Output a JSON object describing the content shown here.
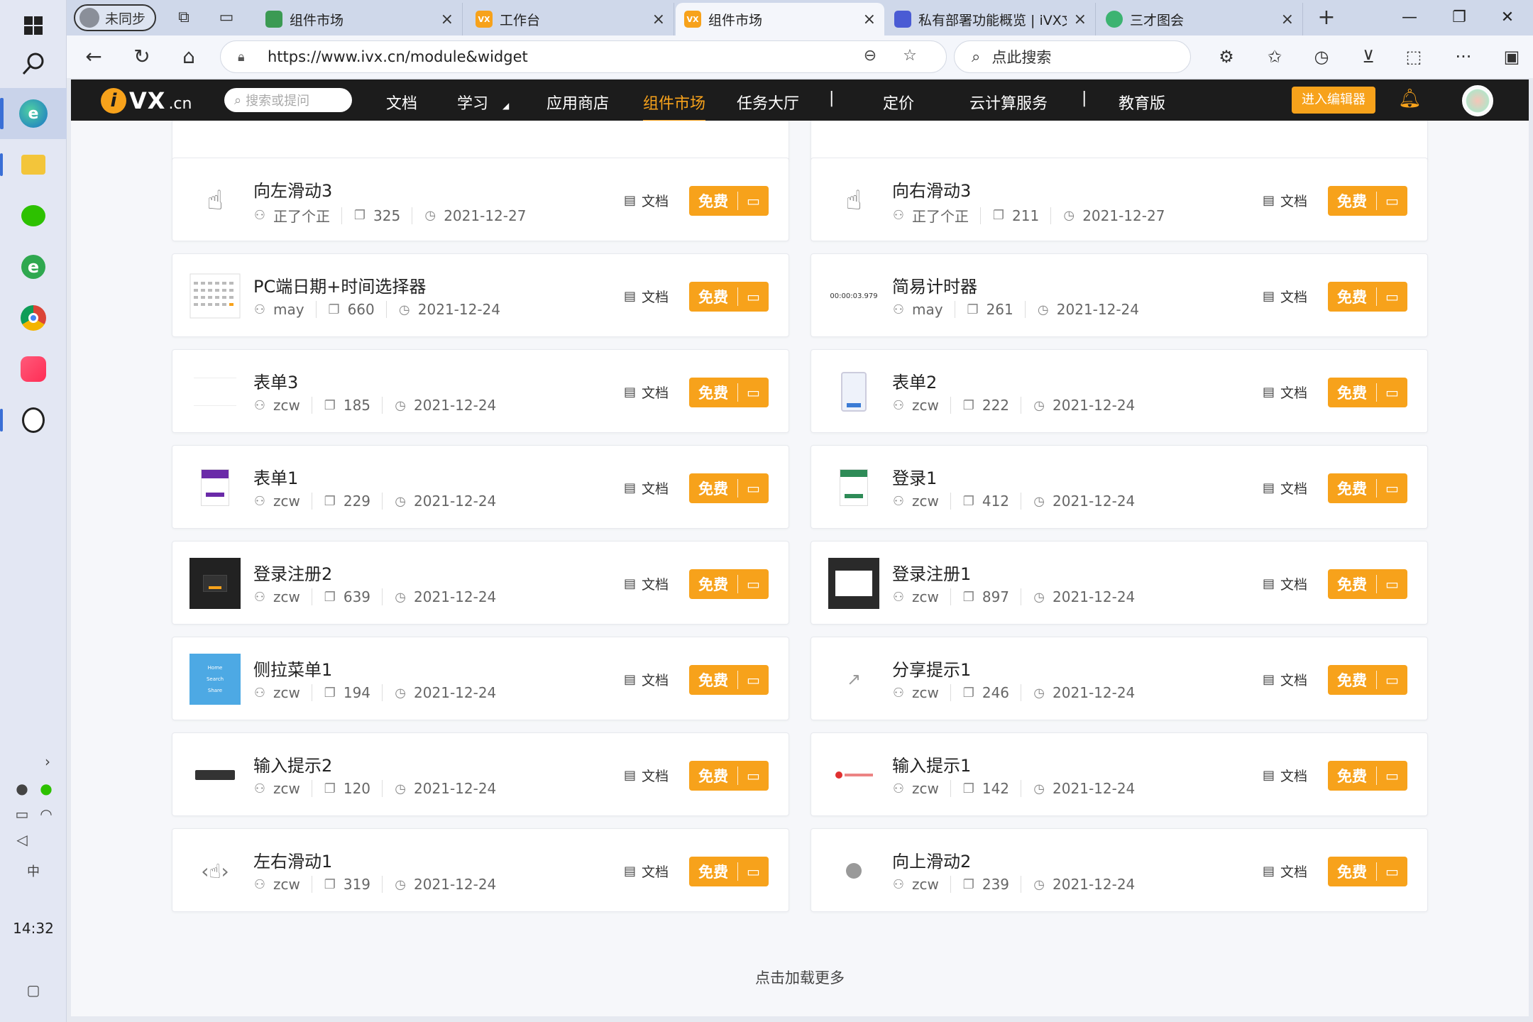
{
  "taskbar": {
    "clock": "14:32"
  },
  "browser": {
    "profile_label": "未同步",
    "tabs": [
      {
        "title": "组件市场",
        "favicon_color": "#3b9a53"
      },
      {
        "title": "工作台",
        "favicon_color": "#f7a21b",
        "favicon_text": "VX"
      },
      {
        "title": "组件市场",
        "favicon_color": "#f7a21b",
        "favicon_text": "VX"
      },
      {
        "title": "私有部署功能概览 | iVX文",
        "favicon_color": "#4a5bd4"
      },
      {
        "title": "三才图会",
        "favicon_color": "#3cb371"
      }
    ],
    "url": "https://www.ivx.cn/module&widget",
    "search_placeholder": "点此搜索"
  },
  "site": {
    "logo_text": "VX",
    "logo_domain": ".cn",
    "search_placeholder": "搜索或提问",
    "nav": [
      {
        "label": "文档"
      },
      {
        "label": "学习"
      },
      {
        "label": "应用商店"
      },
      {
        "label": "组件市场"
      },
      {
        "label": "任务大厅"
      },
      {
        "label": "定价"
      },
      {
        "label": "云计算服务"
      },
      {
        "label": "教育版"
      }
    ],
    "editor_button": "进入编辑器"
  },
  "card_labels": {
    "doc": "文档",
    "free": "免费"
  },
  "cards": [
    {
      "name": "向左滑动3",
      "author": "正了个正",
      "count": "325",
      "date": "2021-12-27"
    },
    {
      "name": "向右滑动3",
      "author": "正了个正",
      "count": "211",
      "date": "2021-12-27"
    },
    {
      "name": "PC端日期+时间选择器",
      "author": "may",
      "count": "660",
      "date": "2021-12-24"
    },
    {
      "name": "简易计时器",
      "author": "may",
      "count": "261",
      "date": "2021-12-24",
      "thumb_text": "00:00:03.979"
    },
    {
      "name": "表单3",
      "author": "zcw",
      "count": "185",
      "date": "2021-12-24"
    },
    {
      "name": "表单2",
      "author": "zcw",
      "count": "222",
      "date": "2021-12-24"
    },
    {
      "name": "表单1",
      "author": "zcw",
      "count": "229",
      "date": "2021-12-24"
    },
    {
      "name": "登录1",
      "author": "zcw",
      "count": "412",
      "date": "2021-12-24"
    },
    {
      "name": "登录注册2",
      "author": "zcw",
      "count": "639",
      "date": "2021-12-24"
    },
    {
      "name": "登录注册1",
      "author": "zcw",
      "count": "897",
      "date": "2021-12-24"
    },
    {
      "name": "侧拉菜单1",
      "author": "zcw",
      "count": "194",
      "date": "2021-12-24"
    },
    {
      "name": "分享提示1",
      "author": "zcw",
      "count": "246",
      "date": "2021-12-24"
    },
    {
      "name": "输入提示2",
      "author": "zcw",
      "count": "120",
      "date": "2021-12-24"
    },
    {
      "name": "输入提示1",
      "author": "zcw",
      "count": "142",
      "date": "2021-12-24"
    },
    {
      "name": "左右滑动1",
      "author": "zcw",
      "count": "319",
      "date": "2021-12-24"
    },
    {
      "name": "向上滑动2",
      "author": "zcw",
      "count": "239",
      "date": "2021-12-24"
    }
  ],
  "load_more": "点击加载更多",
  "colors": {
    "accent": "#f7a21b",
    "header_bg": "#1c1c1c"
  }
}
